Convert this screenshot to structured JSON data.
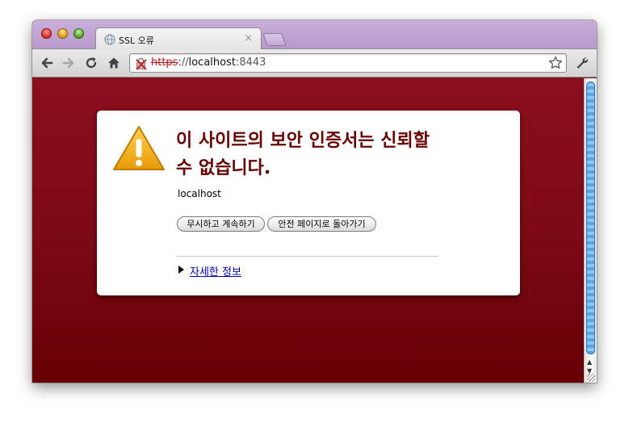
{
  "tab": {
    "title": "SSL 오류",
    "close": "×",
    "favicon": "globe-icon"
  },
  "toolbar": {
    "back_icon": "back-arrow-icon",
    "forward_icon": "forward-arrow-icon",
    "reload_icon": "reload-icon",
    "home_icon": "home-icon",
    "wrench_icon": "wrench-icon"
  },
  "omnibox": {
    "scheme": "https",
    "separator": "://",
    "host": "localhost",
    "port": ":8443",
    "security_icon": "broken-lock-icon",
    "bookmark_icon": "star-icon"
  },
  "interstitial": {
    "heading": "이 사이트의 보안 인증서는 신뢰할 수 없습니다.",
    "hostname": "localhost",
    "proceed_label": "무시하고 계속하기",
    "back_label": "안전 페이지로 돌아가기",
    "more_info_label": "자세한 정보"
  },
  "colors": {
    "background": "#8a0f1c",
    "heading": "#6b0000",
    "link": "#0000cc",
    "tabstrip": "#c9aedb"
  }
}
